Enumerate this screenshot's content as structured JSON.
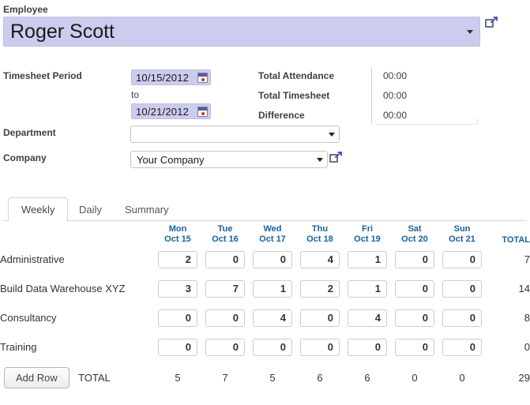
{
  "form": {
    "employee_label": "Employee",
    "employee_value": "Roger Scott",
    "timesheet_period_label": "Timesheet Period",
    "date_from": "10/15/2012",
    "date_to": "10/21/2012",
    "to_text": "to",
    "department_label": "Department",
    "department_value": "",
    "company_label": "Company",
    "company_value": "Your Company"
  },
  "totals_panel": {
    "rows": [
      {
        "label": "Total Attendance",
        "value": "00:00"
      },
      {
        "label": "Total Timesheet",
        "value": "00:00"
      },
      {
        "label": "Difference",
        "value": "00:00"
      }
    ]
  },
  "tabs": {
    "items": [
      {
        "label": "Weekly",
        "active": true
      },
      {
        "label": "Daily",
        "active": false
      },
      {
        "label": "Summary",
        "active": false
      }
    ]
  },
  "timesheet_grid": {
    "columns": [
      {
        "dow": "Mon",
        "date": "Oct 15"
      },
      {
        "dow": "Tue",
        "date": "Oct 16"
      },
      {
        "dow": "Wed",
        "date": "Oct 17"
      },
      {
        "dow": "Thu",
        "date": "Oct 18"
      },
      {
        "dow": "Fri",
        "date": "Oct 19"
      },
      {
        "dow": "Sat",
        "date": "Oct 20"
      },
      {
        "dow": "Sun",
        "date": "Oct 21"
      }
    ],
    "total_header": "TOTAL",
    "rows": [
      {
        "name": "Administrative",
        "values": [
          "2",
          "0",
          "0",
          "4",
          "1",
          "0",
          "0"
        ],
        "total": "7"
      },
      {
        "name": "Build Data Warehouse XYZ",
        "values": [
          "3",
          "7",
          "1",
          "2",
          "1",
          "0",
          "0"
        ],
        "total": "14"
      },
      {
        "name": "Consultancy",
        "values": [
          "0",
          "0",
          "4",
          "0",
          "4",
          "0",
          "0"
        ],
        "total": "8"
      },
      {
        "name": "Training",
        "values": [
          "0",
          "0",
          "0",
          "0",
          "0",
          "0",
          "0"
        ],
        "total": "0"
      }
    ],
    "footer": {
      "add_row_label": "Add Row",
      "total_label": "TOTAL",
      "day_totals": [
        "5",
        "7",
        "5",
        "6",
        "6",
        "0",
        "0"
      ],
      "grand_total": "29"
    }
  },
  "icons": {
    "employee_external_link": "external-link-icon",
    "company_external_link": "external-link-icon",
    "calendar": "calendar-icon",
    "dropdown": "chevron-down-icon"
  },
  "colors": {
    "field_highlight": "#ccccee",
    "day_header": "#16639c",
    "text": "#333333"
  }
}
